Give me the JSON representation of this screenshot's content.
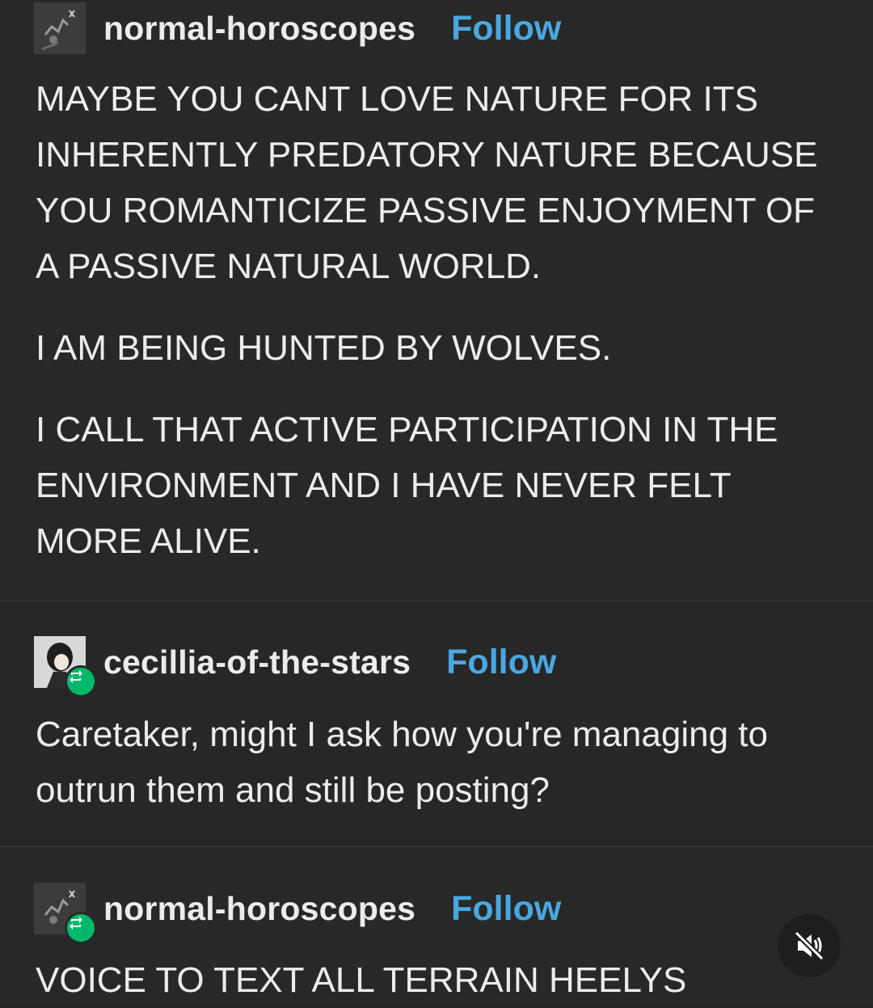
{
  "posts": [
    {
      "username": "normal-horoscopes",
      "follow_label": "Follow",
      "paragraphs": [
        "MAYBE YOU CANT LOVE NATURE FOR ITS INHERENTLY PREDATORY NATURE BECAUSE YOU ROMANTICIZE PASSIVE ENJOYMENT OF A PASSIVE NATURAL WORLD.",
        "I AM BEING HUNTED BY WOLVES.",
        "I CALL THAT ACTIVE PARTICIPATION IN THE ENVIRONMENT AND I HAVE NEVER FELT MORE ALIVE."
      ]
    },
    {
      "username": "cecillia-of-the-stars",
      "follow_label": "Follow",
      "paragraphs": [
        "Caretaker, might I ask how you're managing to outrun them and still be posting?"
      ]
    },
    {
      "username": "normal-horoscopes",
      "follow_label": "Follow",
      "paragraphs": [
        "VOICE TO TEXT ALL TERRAIN HEELYS"
      ]
    }
  ],
  "icons": {
    "reblog": "reblog-icon",
    "mute": "speaker-muted-icon"
  },
  "colors": {
    "background": "#282828",
    "text": "#ececec",
    "follow": "#4aa8e0",
    "reblog_badge": "#00b86b"
  }
}
